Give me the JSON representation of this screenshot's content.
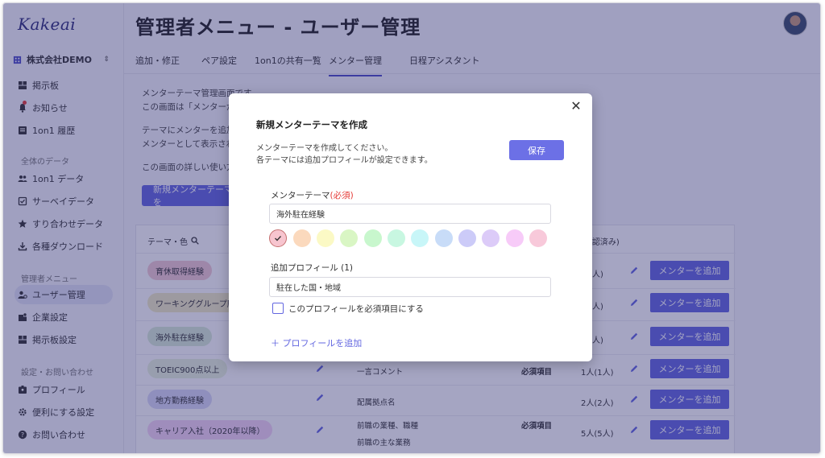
{
  "app": {
    "logo": "Kakeai",
    "company": "株式会社DEMO"
  },
  "page": {
    "title": "管理者メニュー - ユーザー管理"
  },
  "sidebar": {
    "items_top": [
      {
        "label": "掲示板",
        "icon": "board-icon"
      },
      {
        "label": "お知らせ",
        "icon": "bell-icon"
      },
      {
        "label": "1on1 履歴",
        "icon": "history-icon"
      }
    ],
    "section_data": "全体のデータ",
    "items_data": [
      {
        "label": "1on1 データ",
        "icon": "people-icon"
      },
      {
        "label": "サーベイデータ",
        "icon": "survey-icon"
      },
      {
        "label": "すり合わせデータ",
        "icon": "star-icon"
      },
      {
        "label": "各種ダウンロード",
        "icon": "download-icon"
      }
    ],
    "section_admin": "管理者メニュー",
    "items_admin": [
      {
        "label": "ユーザー管理",
        "icon": "user-manage-icon"
      },
      {
        "label": "企業設定",
        "icon": "company-icon"
      },
      {
        "label": "掲示板設定",
        "icon": "board-settings-icon"
      }
    ],
    "section_settings": "設定・お問い合わせ",
    "items_settings": [
      {
        "label": "プロフィール",
        "icon": "profile-icon"
      },
      {
        "label": "便利にする設定",
        "icon": "gear-icon"
      },
      {
        "label": "お問い合わせ",
        "icon": "help-icon"
      }
    ]
  },
  "tabs": [
    "追加・修正",
    "ペア設定",
    "1on1の共有一覧",
    "メンター管理",
    "日程アシスタント"
  ],
  "content": {
    "desc1": "メンターテーマ管理画面です。",
    "desc2": "この画面は「メンターが",
    "desc3": "テーマにメンターを追加す",
    "desc4": "メンターとして表示されま",
    "desc5": "この画面の詳しい使い方は",
    "new_button": "新規メンターテーマを",
    "table": {
      "col_theme": "テーマ・色",
      "col_count": "(承認済み)",
      "rows": [
        {
          "theme": "育休取得経験",
          "color": "#f3cbd4",
          "count": "人)",
          "add": "メンターを追加"
        },
        {
          "theme": "ワーキンググループ所属",
          "color": "#f2ecc4",
          "count": "人)",
          "add": "メンターを追加"
        },
        {
          "theme": "海外駐在経験",
          "color": "#d9ecd7",
          "count": "人)",
          "add": "メンターを追加"
        },
        {
          "theme": "TOEIC900点以上",
          "color": "#e8f3dc",
          "profile": "一言コメント",
          "required": "必須項目",
          "count": "1人(1人)",
          "add": "メンターを追加"
        },
        {
          "theme": "地方勤務経験",
          "color": "#dadaf6",
          "profile": "配属拠点名",
          "count": "2人(2人)",
          "add": "メンターを追加"
        },
        {
          "theme": "キャリア入社（2020年以降）",
          "color": "#f4d6f4",
          "profile": "前職の業種、職種",
          "profile2": "前職の主な業務",
          "required": "必須項目",
          "count": "5人(5人)",
          "add": "メンターを追加"
        }
      ]
    }
  },
  "modal": {
    "title": "新規メンターテーマを作成",
    "desc1": "メンターテーマを作成してください。",
    "desc2": "各テーマには追加プロフィールが設定できます。",
    "save": "保存",
    "theme_label": "メンターテーマ",
    "required_mark": "(必須)",
    "theme_value": "海外駐在経験",
    "colors": [
      "#f7c5cf",
      "#fbd9bd",
      "#fbf9c5",
      "#d9f6c4",
      "#c8f7cd",
      "#c8f7e1",
      "#c8f6f8",
      "#c8dcf8",
      "#cccbf8",
      "#dccbf8",
      "#f7cbf8",
      "#f8c9da"
    ],
    "profile_label": "追加プロフィール (1)",
    "profile_value": "駐在した国・地域",
    "required_checkbox": "このプロフィールを必須項目にする",
    "add_profile": "＋ プロフィールを追加"
  }
}
